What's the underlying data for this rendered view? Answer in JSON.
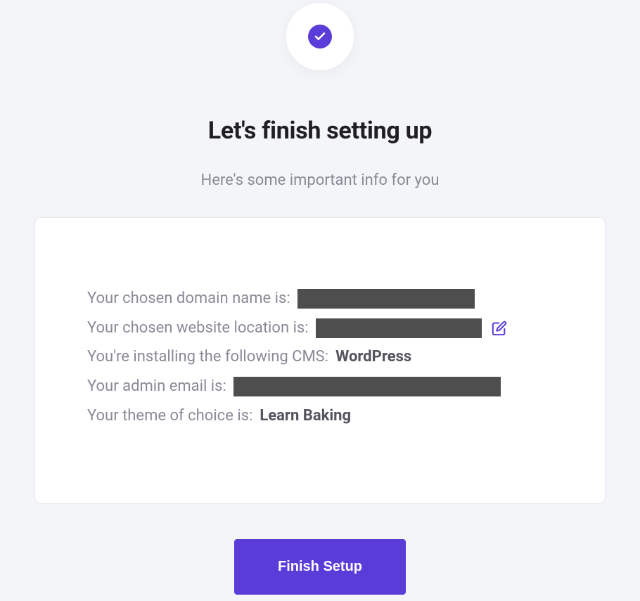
{
  "header": {
    "title": "Let's finish setting up",
    "subtitle": "Here's some important info for you"
  },
  "info": {
    "domain_label": "Your chosen domain name is:",
    "location_label": "Your chosen website location is:",
    "cms_label": "You're installing the following CMS:",
    "cms_value": "WordPress",
    "email_label": "Your admin email is:",
    "theme_label": "Your theme of choice is:",
    "theme_value": "Learn Baking"
  },
  "button": {
    "finish_label": "Finish Setup"
  }
}
